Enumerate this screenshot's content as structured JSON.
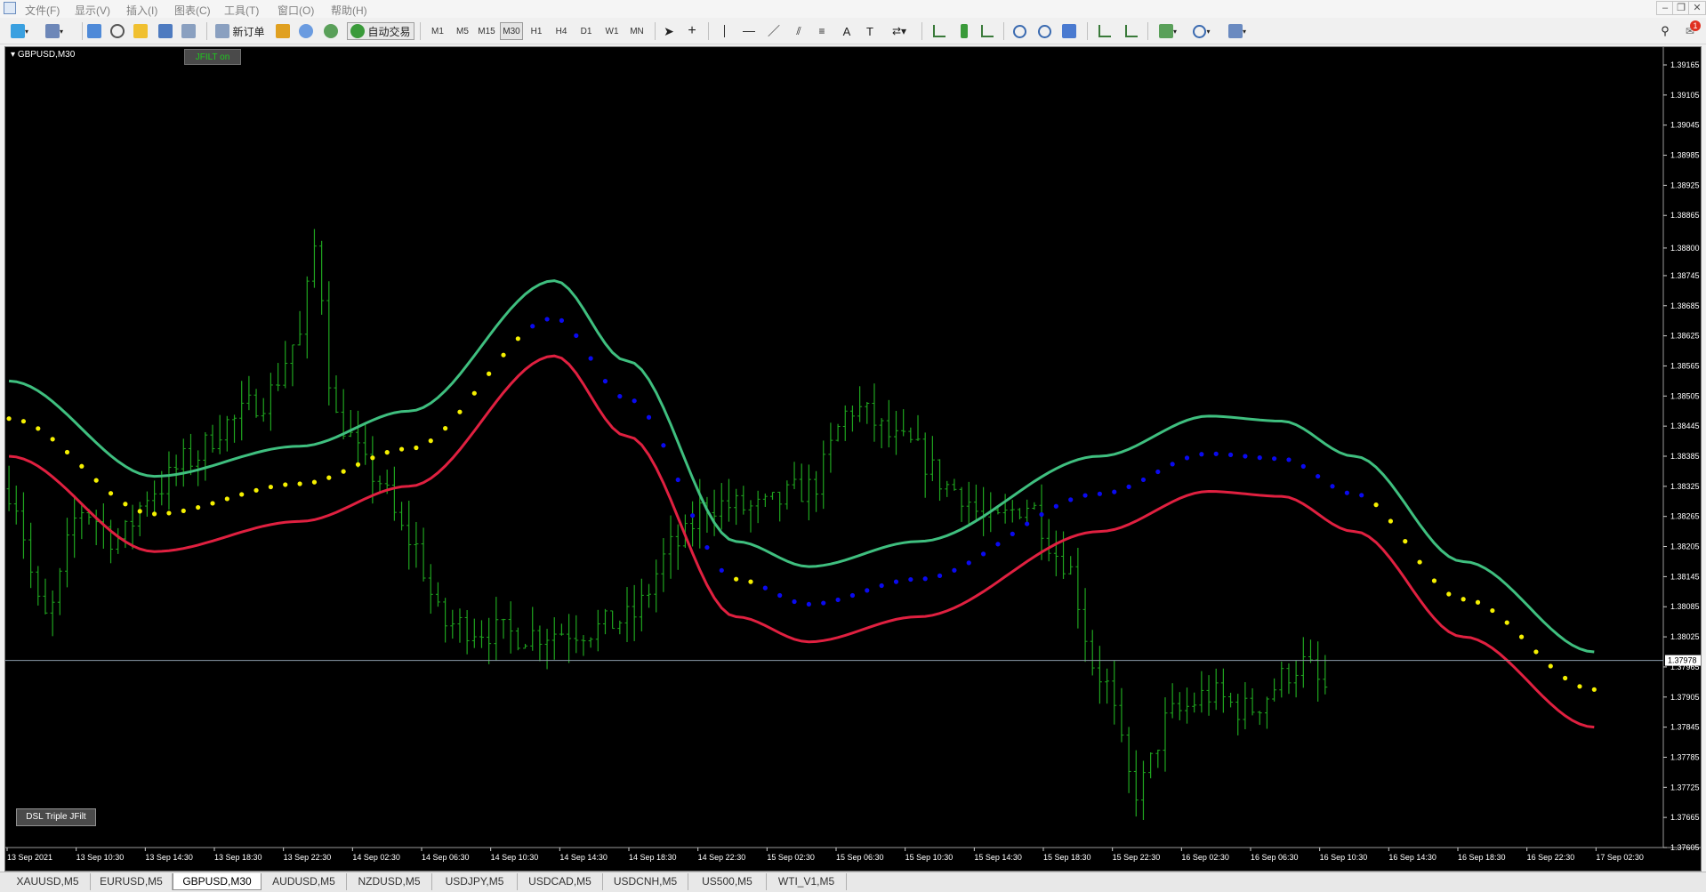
{
  "menu": [
    "文件(F)",
    "显示(V)",
    "插入(I)",
    "图表(C)",
    "工具(T)",
    "窗口(O)",
    "帮助(H)"
  ],
  "toolbar": {
    "new_order": "新订单",
    "auto_trading": "自动交易",
    "timeframes": [
      "M1",
      "M5",
      "M15",
      "M30",
      "H1",
      "H4",
      "D1",
      "W1",
      "MN"
    ],
    "active_timeframe": "M30",
    "notification_count": "1"
  },
  "chart": {
    "symbol_label": "GBPUSD,M30",
    "jfilt_button": "JFILT on",
    "dsl_button": "DSL Triple JFilt",
    "current_price": "1.37978",
    "colors": {
      "background": "#000000",
      "bull": "#1fa51f",
      "upper_band": "#3fbf7f",
      "lower_band": "#e02040",
      "dot_up": "#0a0af0",
      "dot_down": "#f5f000",
      "axis": "#ffffff"
    }
  },
  "chart_data": {
    "type": "candlestick",
    "symbol": "GBPUSD",
    "timeframe": "M30",
    "y_ticks": [
      "1.39165",
      "1.39105",
      "1.39045",
      "1.38985",
      "1.38925",
      "1.38865",
      "1.38800",
      "1.38745",
      "1.38685",
      "1.38625",
      "1.38565",
      "1.38505",
      "1.38445",
      "1.38385",
      "1.38325",
      "1.38265",
      "1.38205",
      "1.38145",
      "1.38085",
      "1.38025",
      "1.37965",
      "1.37905",
      "1.37845",
      "1.37785",
      "1.37725",
      "1.37665",
      "1.37605"
    ],
    "x_ticks": [
      "13 Sep 2021",
      "13 Sep 10:30",
      "13 Sep 14:30",
      "13 Sep 18:30",
      "13 Sep 22:30",
      "14 Sep 02:30",
      "14 Sep 06:30",
      "14 Sep 10:30",
      "14 Sep 14:30",
      "14 Sep 18:30",
      "14 Sep 22:30",
      "15 Sep 02:30",
      "15 Sep 06:30",
      "15 Sep 10:30",
      "15 Sep 14:30",
      "15 Sep 18:30",
      "15 Sep 22:30",
      "16 Sep 02:30",
      "16 Sep 06:30",
      "16 Sep 10:30",
      "16 Sep 14:30",
      "16 Sep 18:30",
      "16 Sep 22:30",
      "17 Sep 02:30"
    ],
    "ylim": [
      1.37605,
      1.39165
    ],
    "last_price": 1.37978,
    "price_knots": [
      [
        0,
        1.3832
      ],
      [
        5,
        1.3806
      ],
      [
        10,
        1.3828
      ],
      [
        15,
        1.3822
      ],
      [
        20,
        1.3832
      ],
      [
        25,
        1.3838
      ],
      [
        30,
        1.3845
      ],
      [
        35,
        1.385
      ],
      [
        40,
        1.3862
      ],
      [
        42,
        1.388
      ],
      [
        45,
        1.3846
      ],
      [
        50,
        1.3835
      ],
      [
        55,
        1.3822
      ],
      [
        60,
        1.3805
      ],
      [
        70,
        1.3803
      ],
      [
        80,
        1.3804
      ],
      [
        85,
        1.3806
      ],
      [
        92,
        1.3821
      ],
      [
        96,
        1.3829
      ],
      [
        103,
        1.3828
      ],
      [
        110,
        1.3832
      ],
      [
        116,
        1.3848
      ],
      [
        123,
        1.3841
      ],
      [
        130,
        1.3832
      ],
      [
        135,
        1.3825
      ],
      [
        140,
        1.3829
      ],
      [
        145,
        1.3818
      ],
      [
        150,
        1.3795
      ],
      [
        155,
        1.3772
      ],
      [
        160,
        1.3787
      ],
      [
        165,
        1.3791
      ],
      [
        170,
        1.3788
      ],
      [
        178,
        1.3797
      ],
      [
        181,
        1.3792
      ]
    ],
    "band_knots": [
      [
        0,
        1.3846
      ],
      [
        20,
        1.3827
      ],
      [
        40,
        1.3833
      ],
      [
        55,
        1.384
      ],
      [
        75,
        1.3866
      ],
      [
        85,
        1.385
      ],
      [
        100,
        1.3814
      ],
      [
        110,
        1.3809
      ],
      [
        125,
        1.3814
      ],
      [
        150,
        1.3831
      ],
      [
        165,
        1.3839
      ],
      [
        175,
        1.3838
      ],
      [
        185,
        1.3831
      ],
      [
        200,
        1.381
      ],
      [
        218,
        1.3792
      ]
    ],
    "band_width": 0.00075,
    "dot_color_switch_points": [
      30,
      72,
      100,
      103,
      188
    ],
    "dot_colors": [
      "yellow",
      "blue",
      "yellow",
      "blue",
      "yellow"
    ]
  },
  "tabs": [
    "XAUUSD,M5",
    "EURUSD,M5",
    "GBPUSD,M30",
    "AUDUSD,M5",
    "NZDUSD,M5",
    "USDJPY,M5",
    "USDCAD,M5",
    "USDCNH,M5",
    "US500,M5",
    "WTI_V1,M5"
  ],
  "active_tab": "GBPUSD,M30"
}
